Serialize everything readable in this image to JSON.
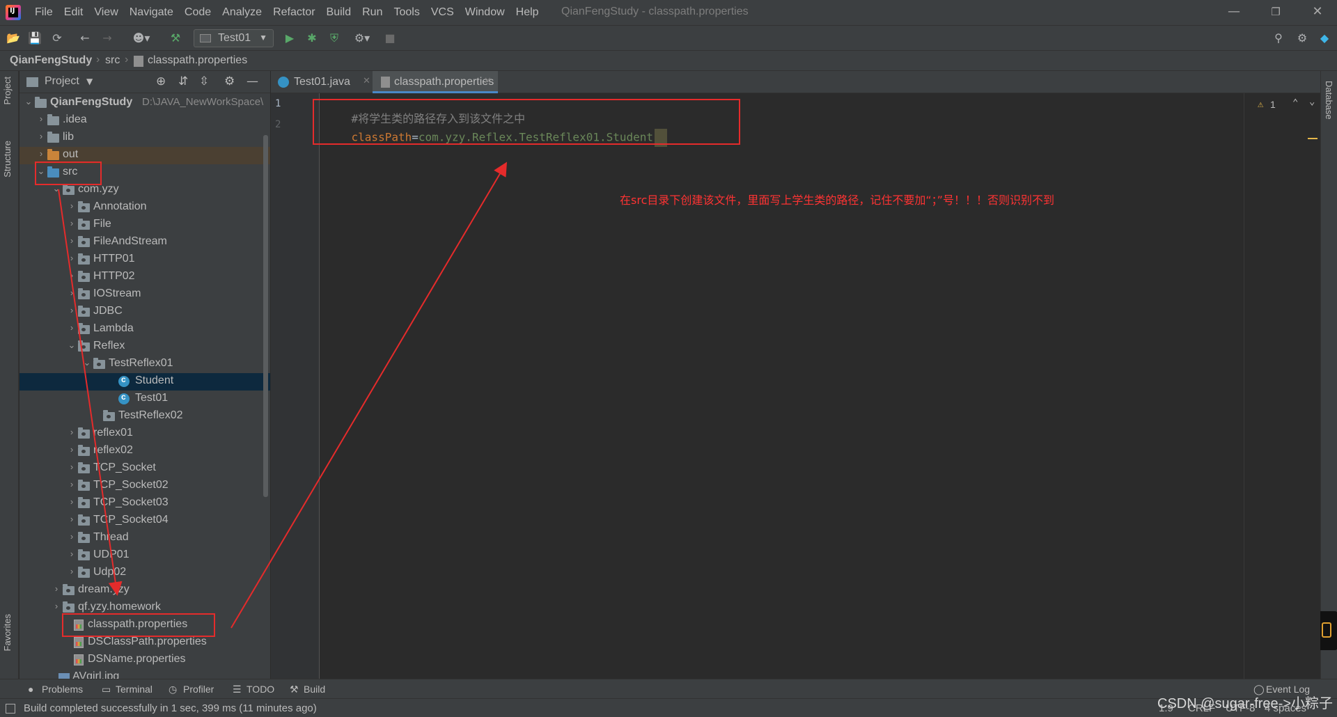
{
  "menubar": {
    "items": [
      "File",
      "Edit",
      "View",
      "Navigate",
      "Code",
      "Analyze",
      "Refactor",
      "Build",
      "Run",
      "Tools",
      "VCS",
      "Window",
      "Help"
    ],
    "window_title": "QianFengStudy - classpath.properties"
  },
  "toolbar": {
    "run_config": "Test01"
  },
  "breadcrumb": {
    "items": [
      "QianFengStudy",
      "src",
      "classpath.properties"
    ]
  },
  "left_strip": {
    "project": "Project",
    "structure": "Structure",
    "favorites": "Favorites"
  },
  "right_strip": {
    "database": "Database"
  },
  "project_panel": {
    "title": "Project",
    "tree": [
      {
        "label": "QianFengStudy",
        "path": "D:\\JAVA_NewWorkSpace\\"
      },
      {
        "label": ".idea"
      },
      {
        "label": "lib"
      },
      {
        "label": "out"
      },
      {
        "label": "src"
      },
      {
        "label": "com.yzy"
      },
      {
        "label": "Annotation"
      },
      {
        "label": "File"
      },
      {
        "label": "FileAndStream"
      },
      {
        "label": "HTTP01"
      },
      {
        "label": "HTTP02"
      },
      {
        "label": "IOStream"
      },
      {
        "label": "JDBC"
      },
      {
        "label": "Lambda"
      },
      {
        "label": "Reflex"
      },
      {
        "label": "TestReflex01"
      },
      {
        "label": "Student"
      },
      {
        "label": "Test01"
      },
      {
        "label": "TestReflex02"
      },
      {
        "label": "reflex01"
      },
      {
        "label": "reflex02"
      },
      {
        "label": "TCP_Socket"
      },
      {
        "label": "TCP_Socket02"
      },
      {
        "label": "TCP_Socket03"
      },
      {
        "label": "TCP_Socket04"
      },
      {
        "label": "Thread"
      },
      {
        "label": "UDP01"
      },
      {
        "label": "Udp02"
      },
      {
        "label": "dream.yzy"
      },
      {
        "label": "qf.yzy.homework"
      },
      {
        "label": "classpath.properties"
      },
      {
        "label": "DSClassPath.properties"
      },
      {
        "label": "DSName.properties"
      },
      {
        "label": "AVgirl.jpg"
      }
    ]
  },
  "editor_tabs": [
    {
      "label": "Test01.java"
    },
    {
      "label": "classpath.properties"
    }
  ],
  "editor": {
    "line_numbers": [
      "1",
      "2"
    ],
    "line1_comment": "#将学生类的路径存入到该文件之中",
    "line2_key": "classPath",
    "line2_eq": "=",
    "line2_value": "com.yzy.Reflex.TestReflex01.Student",
    "warning_count": "1"
  },
  "annotation": {
    "text": "在src目录下创建该文件，里面写上学生类的路径，记住不要加“；”号！！！否则识别不到"
  },
  "bottom_tools": {
    "problems": "Problems",
    "terminal": "Terminal",
    "profiler": "Profiler",
    "todo": "TODO",
    "build": "Build",
    "event_log": "Event Log"
  },
  "status": {
    "message": "Build completed successfully in 1 sec, 399 ms (11 minutes ago)",
    "position": "1:9",
    "line_sep": "CRLF",
    "encoding": "UTF-8",
    "indent": "4 spaces"
  },
  "watermark": "CSDN @sugar-free->小粽子",
  "colors": {
    "annotation_red": "#e52b2b",
    "selection": "#0d293e",
    "accent_tab": "#4a88c7"
  }
}
